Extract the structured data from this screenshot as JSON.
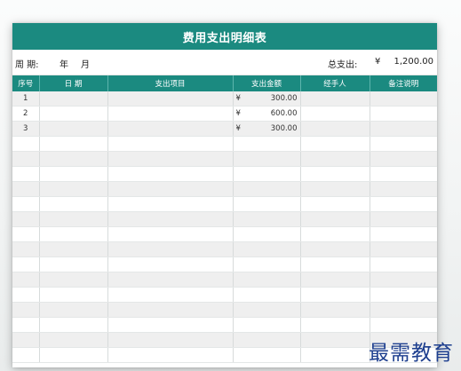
{
  "title": "费用支出明细表",
  "info": {
    "period_label": "周 期:",
    "year_label": "年",
    "month_label": "月",
    "total_label": "总支出:",
    "total_currency": "¥",
    "total_amount": "1,200.00"
  },
  "table": {
    "headers": [
      "序号",
      "日 期",
      "支出项目",
      "支出金额",
      "经手人",
      "备注说明"
    ],
    "rows": [
      {
        "no": "1",
        "date": "",
        "item": "",
        "currency": "¥",
        "amount": "300.00",
        "handler": "",
        "note": ""
      },
      {
        "no": "2",
        "date": "",
        "item": "",
        "currency": "¥",
        "amount": "600.00",
        "handler": "",
        "note": ""
      },
      {
        "no": "3",
        "date": "",
        "item": "",
        "currency": "¥",
        "amount": "300.00",
        "handler": "",
        "note": ""
      },
      {
        "no": "",
        "date": "",
        "item": "",
        "currency": "",
        "amount": "",
        "handler": "",
        "note": ""
      },
      {
        "no": "",
        "date": "",
        "item": "",
        "currency": "",
        "amount": "",
        "handler": "",
        "note": ""
      },
      {
        "no": "",
        "date": "",
        "item": "",
        "currency": "",
        "amount": "",
        "handler": "",
        "note": ""
      },
      {
        "no": "",
        "date": "",
        "item": "",
        "currency": "",
        "amount": "",
        "handler": "",
        "note": ""
      },
      {
        "no": "",
        "date": "",
        "item": "",
        "currency": "",
        "amount": "",
        "handler": "",
        "note": ""
      },
      {
        "no": "",
        "date": "",
        "item": "",
        "currency": "",
        "amount": "",
        "handler": "",
        "note": ""
      },
      {
        "no": "",
        "date": "",
        "item": "",
        "currency": "",
        "amount": "",
        "handler": "",
        "note": ""
      },
      {
        "no": "",
        "date": "",
        "item": "",
        "currency": "",
        "amount": "",
        "handler": "",
        "note": ""
      },
      {
        "no": "",
        "date": "",
        "item": "",
        "currency": "",
        "amount": "",
        "handler": "",
        "note": ""
      },
      {
        "no": "",
        "date": "",
        "item": "",
        "currency": "",
        "amount": "",
        "handler": "",
        "note": ""
      },
      {
        "no": "",
        "date": "",
        "item": "",
        "currency": "",
        "amount": "",
        "handler": "",
        "note": ""
      },
      {
        "no": "",
        "date": "",
        "item": "",
        "currency": "",
        "amount": "",
        "handler": "",
        "note": ""
      },
      {
        "no": "",
        "date": "",
        "item": "",
        "currency": "",
        "amount": "",
        "handler": "",
        "note": ""
      },
      {
        "no": "",
        "date": "",
        "item": "",
        "currency": "",
        "amount": "",
        "handler": "",
        "note": ""
      },
      {
        "no": "",
        "date": "",
        "item": "",
        "currency": "",
        "amount": "",
        "handler": "",
        "note": ""
      }
    ]
  },
  "watermark": "最需教育",
  "colors": {
    "header_teal": "#1b8a80",
    "stripe_gray": "#efefef",
    "watermark_blue": "#1e3f8f"
  }
}
